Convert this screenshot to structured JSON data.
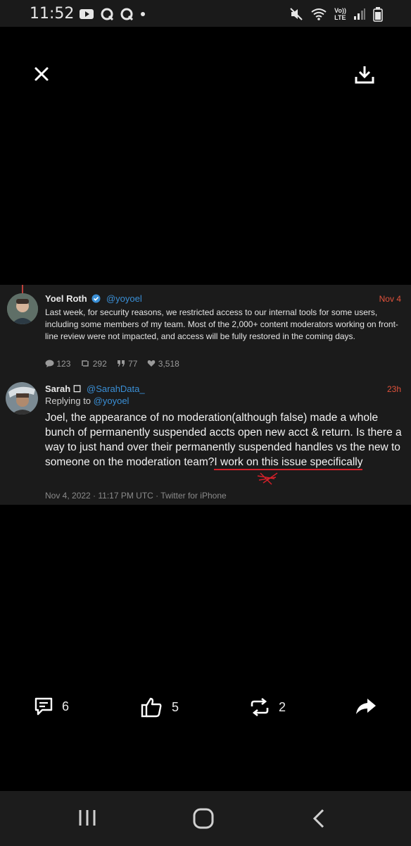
{
  "status_bar": {
    "time": "11:52",
    "network_label_top": "Vo))",
    "network_label_bottom": "LTE"
  },
  "viewer": {
    "close_icon": "close-icon",
    "download_icon": "download-icon"
  },
  "post": {
    "author": "Yoel Roth",
    "handle": "@yoyoel",
    "date": "Nov 4",
    "text": "Last week, for security reasons, we restricted access to our internal tools for some users, including some members of my team. Most of the 2,000+ content moderators working on front-line review were not impacted, and access will be fully restored in the coming days.",
    "stats": {
      "replies": "123",
      "retweets": "292",
      "quotes": "77",
      "likes": "3,518"
    }
  },
  "reply": {
    "author": "Sarah ☐",
    "handle": "@SarahData_",
    "date": "23h",
    "replying_label": "Replying to",
    "replying_handle": "@yoyoel",
    "text_main": "Joel, the appearance of no moderation(although false) made a whole bunch of permanently suspended accts open new acct & return. Is there a way to just hand over their permanently suspended handles vs the new to someone on the moderation team?",
    "text_highlight": "I work on this issue specifically",
    "meta": "Nov 4, 2022 · 11:17 PM UTC · Twitter for iPhone"
  },
  "actions": {
    "comments": "6",
    "likes": "5",
    "shares": "2"
  },
  "colors": {
    "accent_blue": "#3a8fd6",
    "date_red": "#e0523b",
    "underline_red": "#d6202a"
  }
}
